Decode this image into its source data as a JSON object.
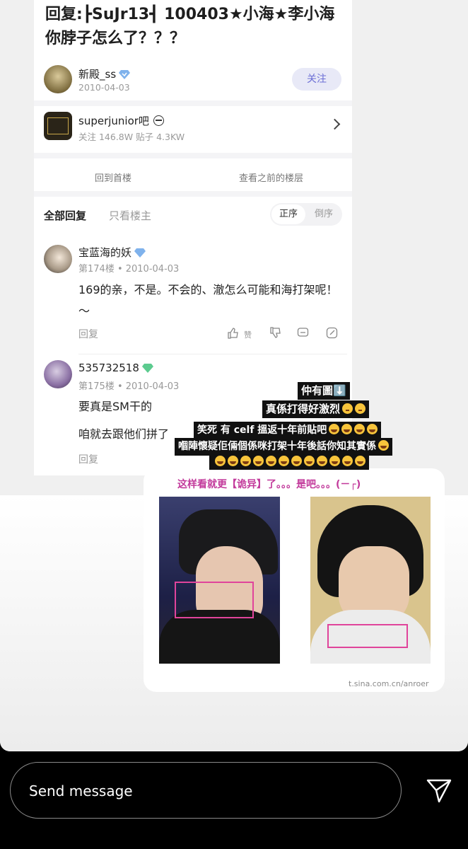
{
  "post": {
    "title": "回复:┣SuJr13┫ 100403★小海★李小海你脖子怎么了？？？",
    "author": "新殿_ss",
    "date": "2010-04-03",
    "follow_label": "关注"
  },
  "forum": {
    "name": "superjunior吧",
    "stats": "关注 146.8W  贴子 4.3KW"
  },
  "nav": {
    "back_first": "回到首楼",
    "prev_floors": "查看之前的楼层"
  },
  "tabs": {
    "all": "全部回复",
    "owner_only": "只看楼主",
    "asc": "正序",
    "desc": "倒序"
  },
  "comments": [
    {
      "name": "宝蓝海的妖",
      "meta": "第174楼 • 2010-04-03",
      "text": "169的亲，不是。不会的、澈怎么可能和海打架呢！～",
      "reply": "回复",
      "like": "赞"
    },
    {
      "name": "535732518",
      "meta": "第175楼 • 2010-04-03",
      "line1": "要真是SM干的",
      "line2": "咱就去跟他们拼了",
      "reply": "回复"
    }
  ],
  "stickers": {
    "line1": "仲有圖⬇️",
    "line2": "真係打得好激烈",
    "line3": "笑死 有 celf 搵返十年前貼吧",
    "line4": "嗰陣懷疑佢倆個係咪打架十年後話你知其實係"
  },
  "panel": {
    "caption": "这样看就更【诡异】了。。。是吧。。。(－┌)",
    "watermark": "t.sina.com.cn/anroer"
  },
  "composer": {
    "placeholder": "Send message"
  },
  "colors": {
    "accent": "#6c6fd6",
    "follow_bg": "#e8e9f7",
    "highlight": "#e0449b"
  }
}
